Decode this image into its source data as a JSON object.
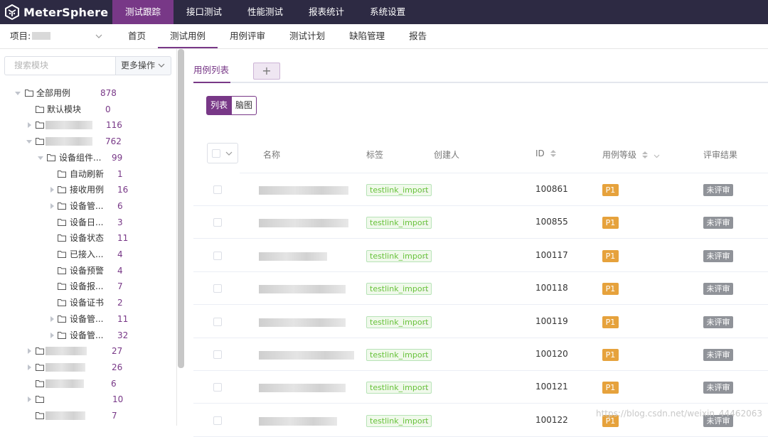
{
  "app": {
    "brand": "MeterSphere",
    "top_nav": [
      "测试跟踪",
      "接口测试",
      "性能测试",
      "报表统计",
      "系统设置"
    ],
    "top_nav_active": "测试跟踪"
  },
  "subbar": {
    "project_label": "项目:",
    "nav": [
      "首页",
      "测试用例",
      "用例评审",
      "测试计划",
      "缺陷管理",
      "报告"
    ],
    "nav_active": "测试用例"
  },
  "sidebar": {
    "search_placeholder": "搜索模块",
    "more_actions": "更多操作",
    "tree": [
      {
        "label": "全部用例",
        "count": "878"
      },
      {
        "label": "默认模块",
        "count": "0"
      },
      {
        "label": "",
        "count": "116"
      },
      {
        "label": "",
        "count": "762"
      },
      {
        "label": "设备组件...",
        "count": "99"
      },
      {
        "label": "自动刷新",
        "count": "1"
      },
      {
        "label": "接收用例",
        "count": "16"
      },
      {
        "label": "设备管...",
        "count": "6"
      },
      {
        "label": "设备日...",
        "count": "3"
      },
      {
        "label": "设备状态",
        "count": "11"
      },
      {
        "label": "已接入...",
        "count": "4"
      },
      {
        "label": "设备预警",
        "count": "4"
      },
      {
        "label": "设备报...",
        "count": "7"
      },
      {
        "label": "设备证书",
        "count": "2"
      },
      {
        "label": "设备管...",
        "count": "11"
      },
      {
        "label": "设备管...",
        "count": "32"
      },
      {
        "label": "",
        "count": "27"
      },
      {
        "label": "",
        "count": "26"
      },
      {
        "label": "",
        "count": "6"
      },
      {
        "label": "",
        "count": "10"
      },
      {
        "label": "",
        "count": "7"
      }
    ]
  },
  "main": {
    "tab_label": "用例列表",
    "tab_add": "+",
    "view_list": "列表",
    "view_mind": "脑图",
    "columns": {
      "name": "名称",
      "tags": "标签",
      "creator": "创建人",
      "id": "ID",
      "priority": "用例等级",
      "review": "评审结果"
    },
    "rows": [
      {
        "tag": "testlink_import",
        "dots": "..",
        "id": "100861",
        "priority": "P1",
        "review": "未评审"
      },
      {
        "tag": "testlink_import",
        "dots": "..",
        "id": "100855",
        "priority": "P1",
        "review": "未评审"
      },
      {
        "tag": "testlink_import",
        "dots": "..",
        "id": "100117",
        "priority": "P1",
        "review": "未评审"
      },
      {
        "tag": "testlink_import",
        "dots": "..",
        "id": "100118",
        "priority": "P1",
        "review": "未评审"
      },
      {
        "tag": "testlink_import",
        "dots": "..",
        "id": "100119",
        "priority": "P1",
        "review": "未评审"
      },
      {
        "tag": "testlink_import",
        "dots": "..",
        "id": "100120",
        "priority": "P1",
        "review": "未评审"
      },
      {
        "tag": "testlink_import",
        "dots": "..",
        "id": "100121",
        "priority": "P1",
        "review": "未评审"
      },
      {
        "tag": "testlink_import",
        "dots": "..",
        "id": "100122",
        "priority": "P1",
        "review": "未评审"
      }
    ]
  },
  "watermark": "https://blog.csdn.net/weixin_44462063",
  "colors": {
    "brand": "#783887",
    "header": "#2d2a43",
    "priority": "#e6a23c",
    "review": "#909399"
  }
}
